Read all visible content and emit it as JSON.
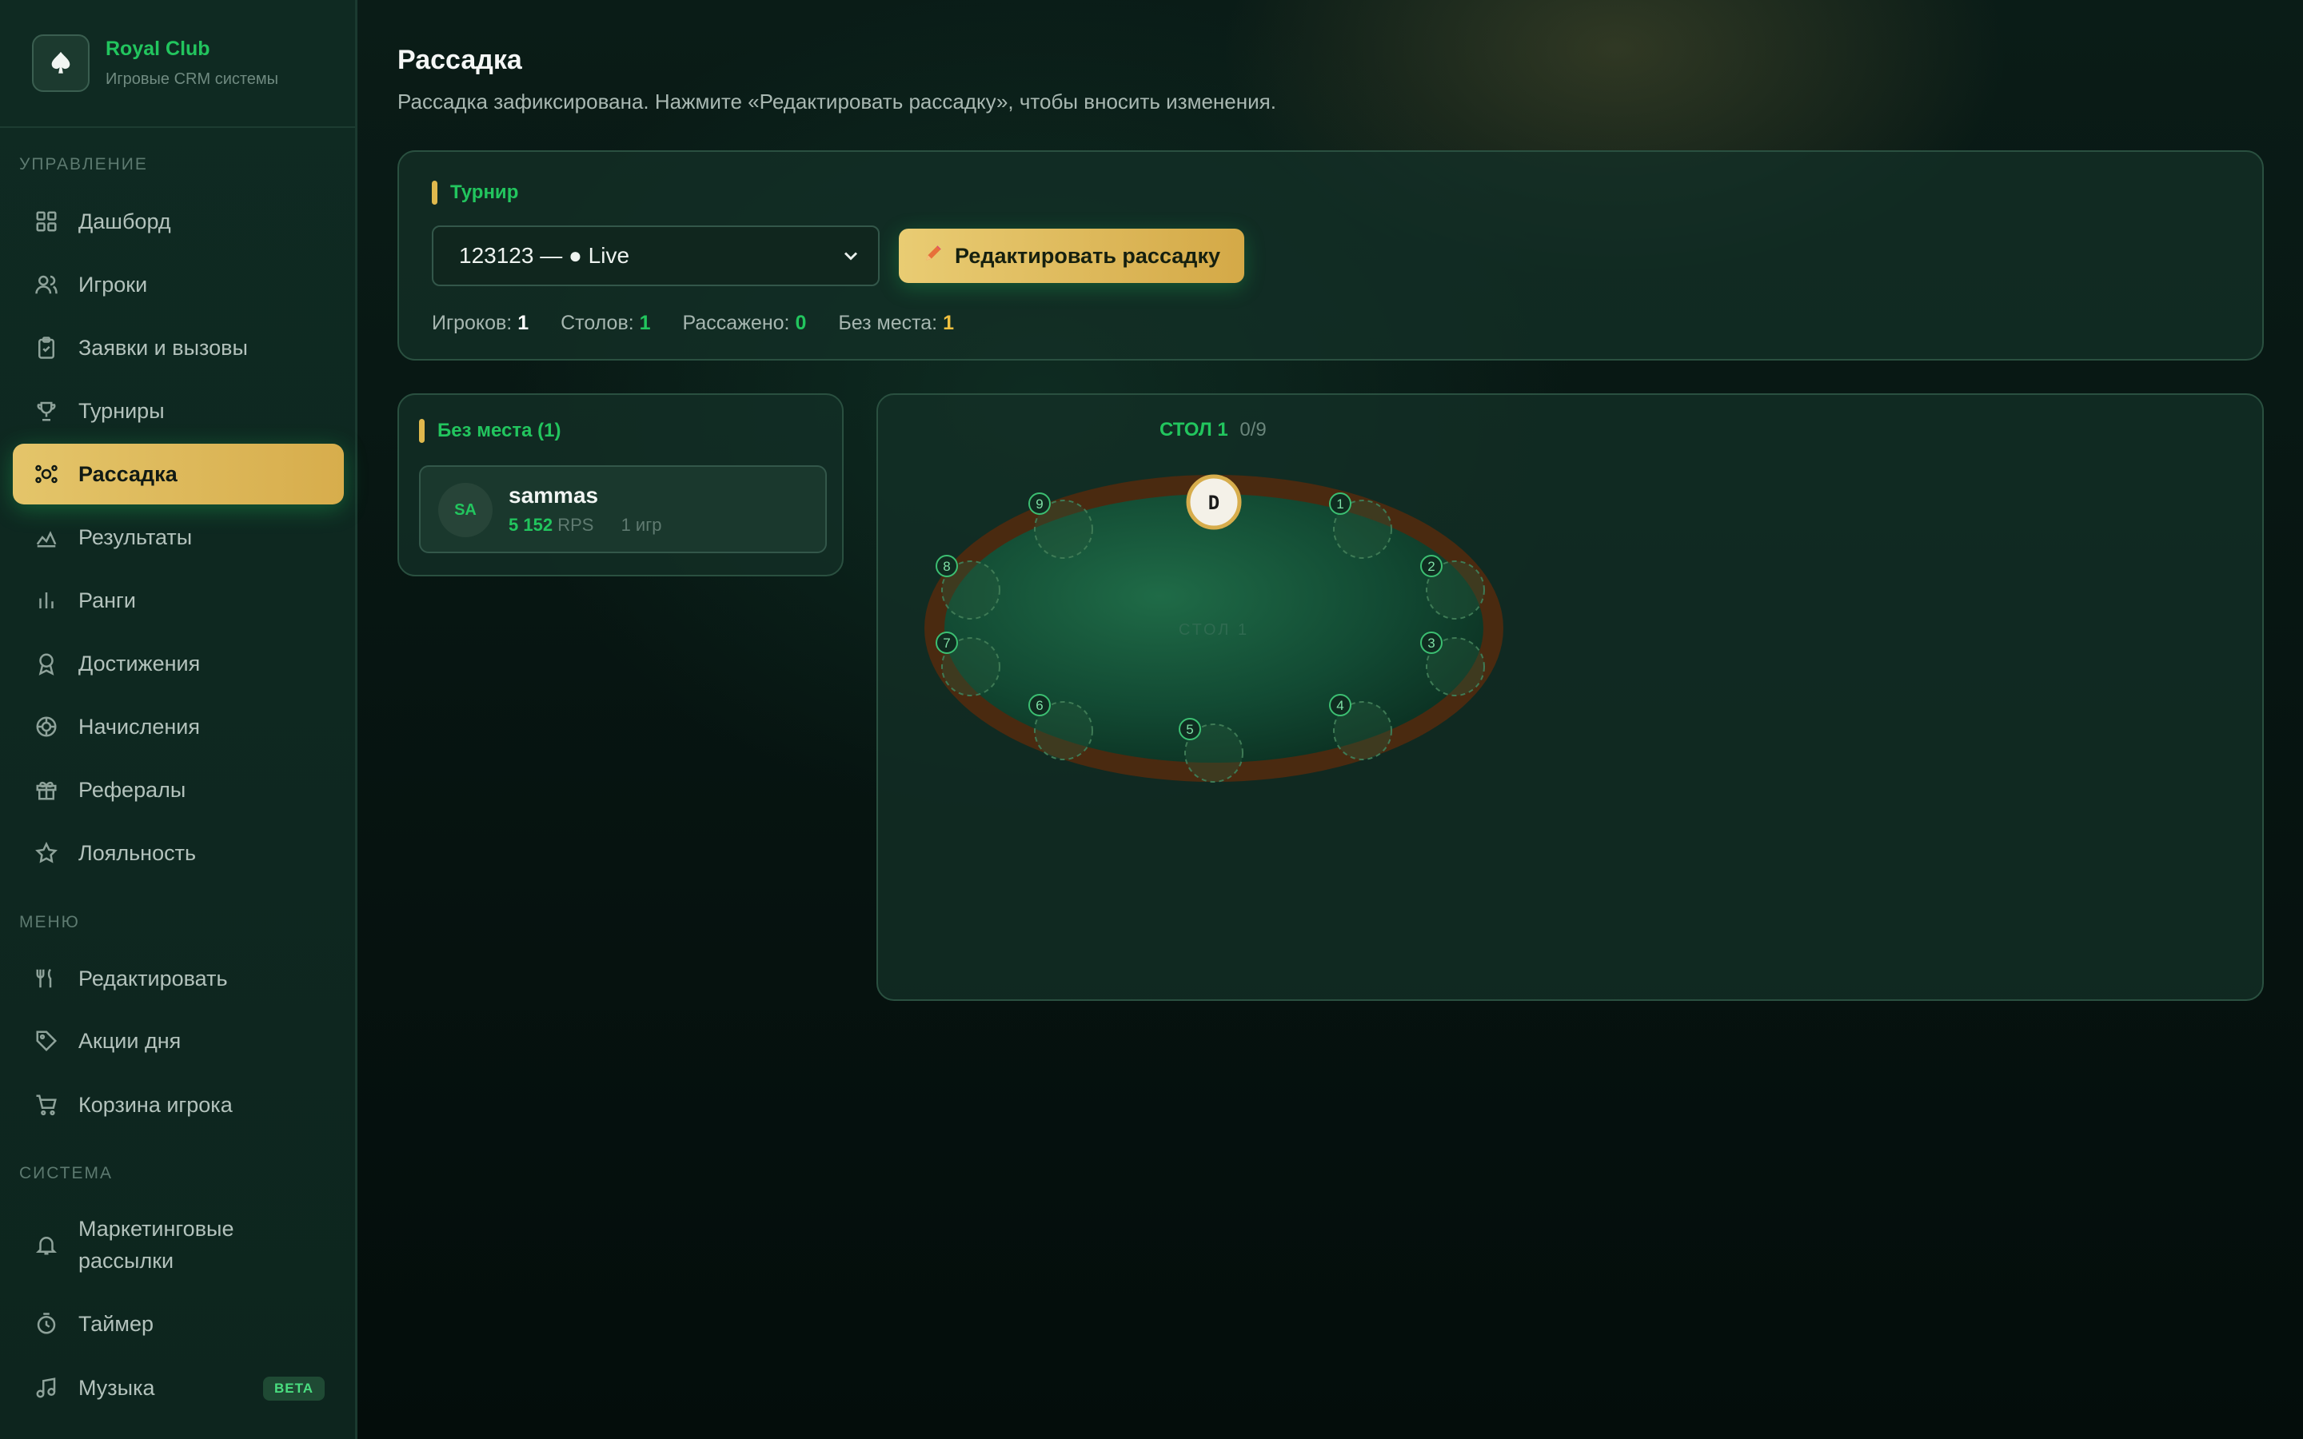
{
  "brand": {
    "name": "Royal Club",
    "subtitle": "Игровые CRM системы",
    "logo_icon": "spade-icon"
  },
  "sidebar": {
    "sections": [
      {
        "label": "УПРАВЛЕНИЕ"
      },
      {
        "label": "МЕНЮ"
      },
      {
        "label": "СИСТЕМА"
      }
    ],
    "items": [
      {
        "label": "Дашборд",
        "icon": "grid-icon"
      },
      {
        "label": "Игроки",
        "icon": "users-icon"
      },
      {
        "label": "Заявки и вызовы",
        "icon": "clipboard-icon"
      },
      {
        "label": "Турниры",
        "icon": "trophy-icon"
      },
      {
        "label": "Рассадка",
        "icon": "seating-icon",
        "active": true
      },
      {
        "label": "Результаты",
        "icon": "chart-line-icon"
      },
      {
        "label": "Ранги",
        "icon": "bar-chart-icon"
      },
      {
        "label": "Достижения",
        "icon": "award-icon"
      },
      {
        "label": "Начисления",
        "icon": "coin-icon"
      },
      {
        "label": "Рефералы",
        "icon": "gift-icon"
      },
      {
        "label": "Лояльность",
        "icon": "star-icon"
      },
      {
        "label": "Редактировать",
        "icon": "utensils-icon"
      },
      {
        "label": "Акции дня",
        "icon": "tag-icon"
      },
      {
        "label": "Корзина игрока",
        "icon": "cart-icon"
      },
      {
        "label": "Маркетинговые рассылки",
        "icon": "bell-icon"
      },
      {
        "label": "Таймер",
        "icon": "timer-icon"
      },
      {
        "label": "Музыка",
        "icon": "music-icon",
        "badge": "BETA"
      }
    ]
  },
  "page": {
    "title": "Рассадка",
    "subtitle": "Рассадка зафиксирована. Нажмите «Редактировать рассадку», чтобы вносить изменения."
  },
  "tournament": {
    "title": "Турнир",
    "selected": "123123 — ● Live",
    "edit_button": "Редактировать рассадку",
    "edit_icon": "pencil-icon",
    "stats": [
      {
        "label": "Игроков:",
        "value": "1"
      },
      {
        "label": "Столов:",
        "value": "1"
      },
      {
        "label": "Рассажено:",
        "value": "0"
      },
      {
        "label": "Без места:",
        "value": "1"
      }
    ]
  },
  "unseated": {
    "title": "Без места (1)",
    "players": [
      {
        "initials": "SA",
        "name": "sammas",
        "points": "5 152",
        "unit": "RPS",
        "games": "1 игр"
      }
    ]
  },
  "table": {
    "name": "СТОЛ 1",
    "count": "0/9",
    "felt_label": "СТОЛ 1",
    "dealer_label": "D",
    "seats": [
      "1",
      "2",
      "3",
      "4",
      "5",
      "6",
      "7",
      "8",
      "9"
    ]
  },
  "colors": {
    "accent_green": "#22c55e",
    "accent_gold": "#e0b94d",
    "warning_yellow": "#f0c040"
  }
}
